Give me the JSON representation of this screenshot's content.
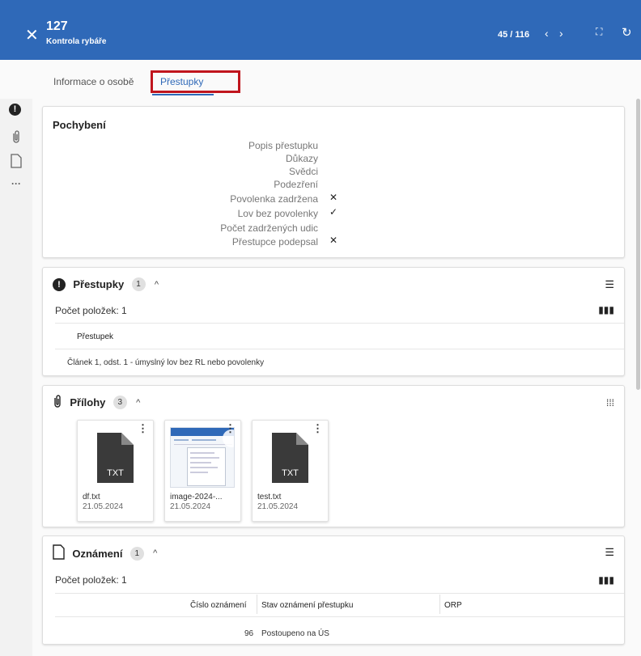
{
  "header": {
    "record_number": "127",
    "record_type": "Kontrola rybáře",
    "pager": "45 / 116",
    "prev_glyph": "‹",
    "next_glyph": "›",
    "bg_color": "#2f69b8"
  },
  "tabs": [
    {
      "label": "Informace o osobě"
    },
    {
      "label": "Přestupky",
      "active": true
    }
  ],
  "rail": [
    "alert-icon",
    "paperclip-icon",
    "document-icon",
    "more-icon"
  ],
  "pochybeni": {
    "title": "Pochybení",
    "rows": [
      {
        "label": "Popis přestupku",
        "mark": ""
      },
      {
        "label": "Důkazy",
        "mark": ""
      },
      {
        "label": "Svědci",
        "mark": ""
      },
      {
        "label": "Podezření",
        "mark": ""
      },
      {
        "label": "Povolenka zadržena",
        "mark": "✕"
      },
      {
        "label": "Lov bez povolenky",
        "mark": "✓"
      },
      {
        "label": "Počet zadržených udic",
        "mark": ""
      },
      {
        "label": "Přestupce podepsal",
        "mark": "✕"
      }
    ]
  },
  "prestupky": {
    "title": "Přestupky",
    "badge": "1",
    "count_label": "Počet položek: 1",
    "column_header": "Přestupek",
    "rows": [
      "Článek 1, odst. 1 - úmyslný lov bez RL nebo povolenky"
    ]
  },
  "prilohy": {
    "title": "Přílohy",
    "badge": "3",
    "files": [
      {
        "name": "df.txt",
        "date": "21.05.2024",
        "kind": "TXT"
      },
      {
        "name": "image-2024-...",
        "date": "21.05.2024",
        "kind": "image"
      },
      {
        "name": "test.txt",
        "date": "21.05.2024",
        "kind": "TXT"
      }
    ]
  },
  "oznameni": {
    "title": "Oznámení",
    "badge": "1",
    "count_label": "Počet položek: 1",
    "columns": [
      "Číslo oznámení",
      "Stav oznámení přestupku",
      "ORP"
    ],
    "rows": [
      {
        "cislo": "96",
        "stav": "Postoupeno na ÚS",
        "orp": ""
      }
    ]
  }
}
